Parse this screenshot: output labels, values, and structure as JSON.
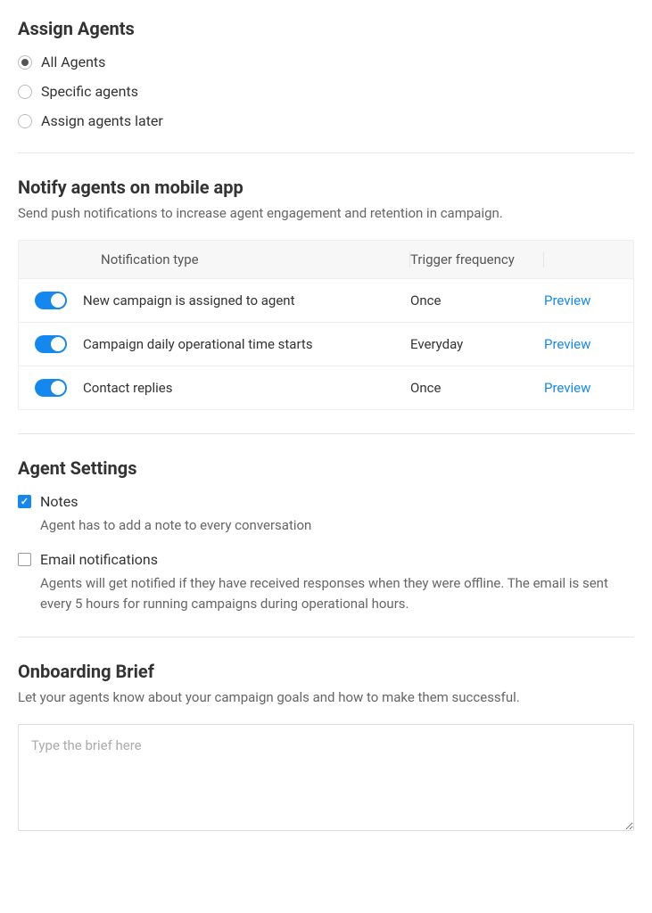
{
  "assignAgents": {
    "title": "Assign Agents",
    "options": [
      {
        "label": "All Agents",
        "selected": true
      },
      {
        "label": "Specific agents",
        "selected": false
      },
      {
        "label": "Assign agents later",
        "selected": false
      }
    ]
  },
  "notify": {
    "title": "Notify agents on mobile app",
    "subtitle": "Send push notifications to increase agent engagement and retention in campaign.",
    "headers": {
      "type": "Notification type",
      "frequency": "Trigger frequency"
    },
    "previewLabel": "Preview",
    "rows": [
      {
        "type": "New campaign is assigned to agent",
        "frequency": "Once",
        "enabled": true
      },
      {
        "type": "Campaign daily operational time starts",
        "frequency": "Everyday",
        "enabled": true
      },
      {
        "type": "Contact replies",
        "frequency": "Once",
        "enabled": true
      }
    ]
  },
  "agentSettings": {
    "title": "Agent Settings",
    "items": [
      {
        "label": "Notes",
        "desc": "Agent has to add a note to every conversation",
        "checked": true
      },
      {
        "label": "Email notifications",
        "desc": "Agents will get notified if they have received responses when they were offline. The email is sent every 5 hours for running campaigns during operational hours.",
        "checked": false
      }
    ]
  },
  "onboarding": {
    "title": "Onboarding Brief",
    "subtitle": "Let your agents know about your campaign goals and how to make them successful.",
    "placeholder": "Type the brief here",
    "value": ""
  }
}
